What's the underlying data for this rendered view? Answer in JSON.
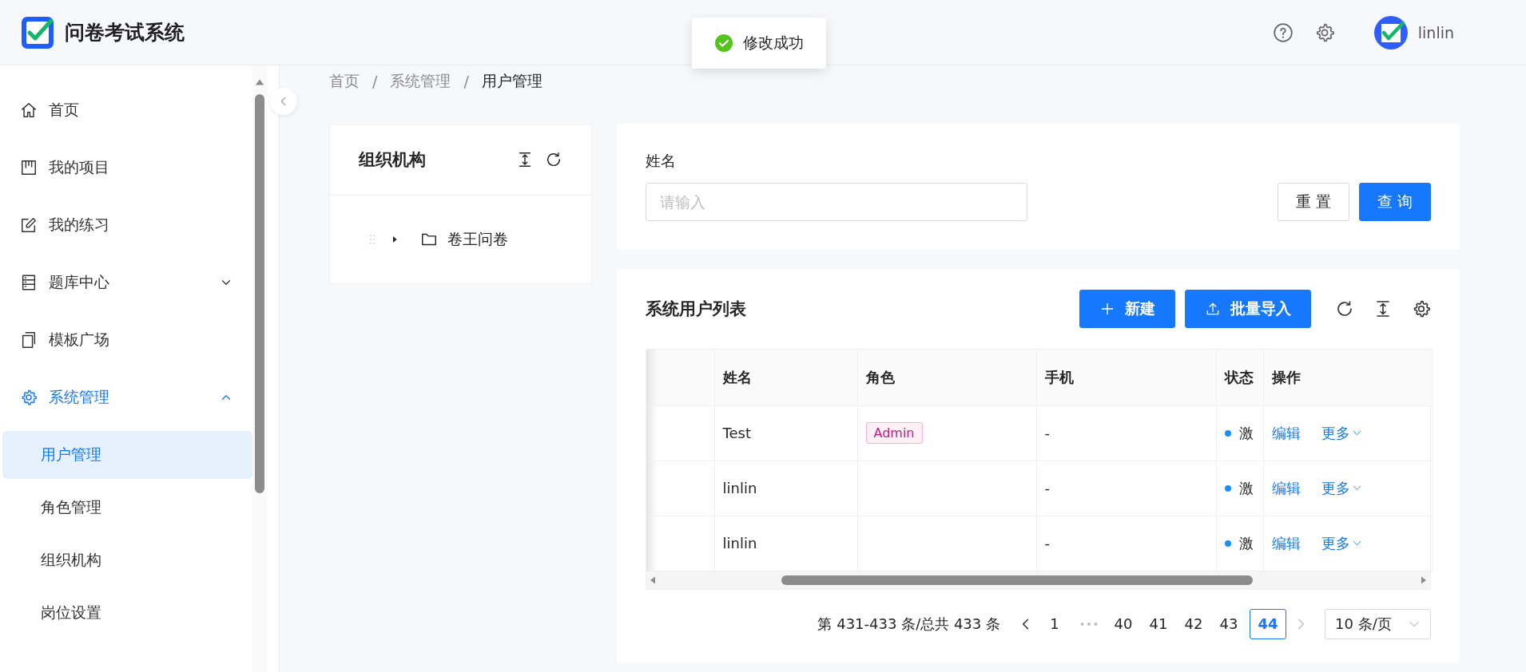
{
  "header": {
    "title": "问卷考试系统",
    "user": "linlin"
  },
  "toast": {
    "kind": "success",
    "text": "修改成功"
  },
  "sidebar": {
    "items": [
      {
        "label": "首页",
        "kind": "link",
        "selected": false
      },
      {
        "label": "我的项目",
        "kind": "link",
        "selected": false
      },
      {
        "label": "我的练习",
        "kind": "link",
        "selected": false
      },
      {
        "label": "题库中心",
        "kind": "group",
        "selected": false,
        "expanded": false
      },
      {
        "label": "模板广场",
        "kind": "link",
        "selected": false
      },
      {
        "label": "系统管理",
        "kind": "group",
        "selected": true,
        "expanded": true,
        "children": [
          {
            "label": "用户管理",
            "selected": true
          },
          {
            "label": "角色管理",
            "selected": false
          },
          {
            "label": "组织机构",
            "selected": false
          },
          {
            "label": "岗位设置",
            "selected": false
          }
        ]
      }
    ]
  },
  "breadcrumb": [
    {
      "kind": "link",
      "label": "首页"
    },
    {
      "kind": "separator",
      "label": "/"
    },
    {
      "kind": "link",
      "label": "系统管理"
    },
    {
      "kind": "separator",
      "label": "/"
    },
    {
      "kind": "current",
      "label": "用户管理"
    }
  ],
  "org_panel": {
    "title": "组织机构",
    "tree": [
      {
        "label": "卷王问卷",
        "expanded": false
      }
    ]
  },
  "search": {
    "label": "姓名",
    "placeholder": "请输入",
    "buttons": [
      {
        "label": "重 置",
        "kind": "default"
      },
      {
        "label": "查 询",
        "kind": "primary"
      }
    ]
  },
  "table": {
    "title": "系统用户列表",
    "buttons": [
      {
        "label": "新建",
        "kind": "add"
      },
      {
        "label": "批量导入",
        "kind": "upload"
      }
    ],
    "columns": [
      {
        "label": "姓名"
      },
      {
        "label": "角色"
      },
      {
        "label": "手机"
      },
      {
        "label": "状态"
      },
      {
        "label": "操作"
      }
    ],
    "rows": [
      {
        "name": "Test",
        "role": "Admin",
        "phone": "-",
        "status": "激",
        "color": "#1890ff",
        "actions": [
          "编辑",
          "更多"
        ]
      },
      {
        "name": "linlin",
        "phone": "-",
        "status": "激",
        "color": "#1890ff",
        "actions": [
          "编辑",
          "更多"
        ]
      },
      {
        "name": "linlin",
        "phone": "-",
        "status": "激",
        "color": "#1890ff",
        "actions": [
          "编辑",
          "更多"
        ]
      }
    ]
  },
  "pagination": {
    "summary": "第 431-433 条/总共 433 条",
    "prev": {
      "disabled": false
    },
    "next": {
      "disabled": true
    },
    "pages": [
      {
        "kind": "page",
        "label": "1",
        "selected": false
      },
      {
        "kind": "ellipsis"
      },
      {
        "kind": "page",
        "label": "40",
        "selected": false
      },
      {
        "kind": "page",
        "label": "41",
        "selected": false
      },
      {
        "kind": "page",
        "label": "42",
        "selected": false
      },
      {
        "kind": "page",
        "label": "43",
        "selected": false
      },
      {
        "kind": "page",
        "label": "44",
        "selected": true
      }
    ],
    "page_size": "10 条/页"
  }
}
